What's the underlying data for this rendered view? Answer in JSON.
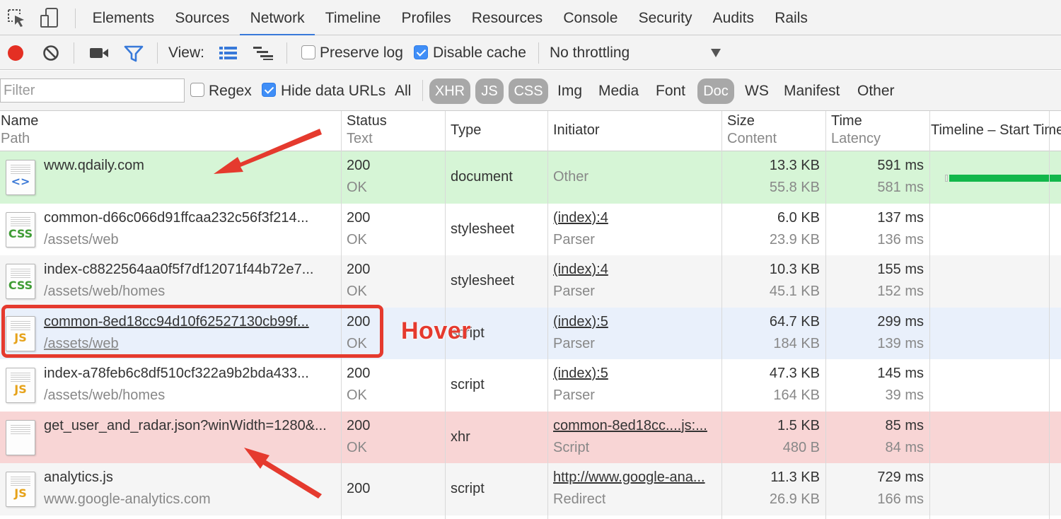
{
  "tabbar": {
    "tabs": [
      "Elements",
      "Sources",
      "Network",
      "Timeline",
      "Profiles",
      "Resources",
      "Console",
      "Security",
      "Audits",
      "Rails"
    ],
    "active": "Network",
    "icons": [
      "inspect-element-icon",
      "device-mode-icon"
    ]
  },
  "toolbar": {
    "view_label": "View:",
    "preserve_log_label": "Preserve log",
    "preserve_log_checked": false,
    "disable_cache_label": "Disable cache",
    "disable_cache_checked": true,
    "throttling_value": "No throttling",
    "icons": [
      "record-icon",
      "clear-icon",
      "capture-screenshots-icon",
      "filter-icon",
      "large-rows-icon",
      "overview-icon",
      "dropdown-arrow-icon"
    ],
    "record_color": "#e42f23",
    "filter_color": "#3879d9"
  },
  "filterbar": {
    "filter_placeholder": "Filter",
    "regex_label": "Regex",
    "regex_checked": false,
    "hide_data_urls_label": "Hide data URLs",
    "hide_data_urls_checked": true,
    "types": [
      {
        "label": "All",
        "selected": false
      },
      {
        "label": "XHR",
        "selected": true
      },
      {
        "label": "JS",
        "selected": true
      },
      {
        "label": "CSS",
        "selected": true
      },
      {
        "label": "Img",
        "selected": false
      },
      {
        "label": "Media",
        "selected": false
      },
      {
        "label": "Font",
        "selected": false
      },
      {
        "label": "Doc",
        "selected": true
      },
      {
        "label": "WS",
        "selected": false
      },
      {
        "label": "Manifest",
        "selected": false
      },
      {
        "label": "Other",
        "selected": false
      }
    ]
  },
  "table": {
    "headers": {
      "name": "Name",
      "path": "Path",
      "status": "Status",
      "text": "Text",
      "type": "Type",
      "initiator": "Initiator",
      "size": "Size",
      "content": "Content",
      "time": "Time",
      "latency": "Latency",
      "timeline": "Timeline – Start Time"
    },
    "rows": [
      {
        "name": "www.qdaily.com",
        "path": "",
        "icon": "html-file-icon",
        "status": "200",
        "text": "OK",
        "type": "document",
        "initiator": "Other",
        "initiator_detail": "",
        "size": "13.3 KB",
        "content": "55.8 KB",
        "time": "591 ms",
        "latency": "581 ms",
        "bg": "#d6f5d6"
      },
      {
        "name": "common-d66c066d91ffcaa232c56f3f214...",
        "path": "/assets/web",
        "icon": "css-file-icon",
        "status": "200",
        "text": "OK",
        "type": "stylesheet",
        "initiator": "(index):4",
        "initiator_detail": "Parser",
        "size": "6.0 KB",
        "content": "23.9 KB",
        "time": "137 ms",
        "latency": "136 ms",
        "bg": "#ffffff"
      },
      {
        "name": "index-c8822564aa0f5f7df12071f44b72e7...",
        "path": "/assets/web/homes",
        "icon": "css-file-icon",
        "status": "200",
        "text": "OK",
        "type": "stylesheet",
        "initiator": "(index):4",
        "initiator_detail": "Parser",
        "size": "10.3 KB",
        "content": "45.1 KB",
        "time": "155 ms",
        "latency": "152 ms",
        "bg": "#f5f5f5"
      },
      {
        "name": "common-8ed18cc94d10f62527130cb99f...",
        "path": "/assets/web",
        "icon": "js-file-icon",
        "status": "200",
        "text": "OK",
        "type": "script",
        "initiator": "(index):5",
        "initiator_detail": "Parser",
        "size": "64.7 KB",
        "content": "184 KB",
        "time": "299 ms",
        "latency": "139 ms",
        "bg": "#e9f0fb"
      },
      {
        "name": "index-a78feb6c8df510cf322a9b2bda433...",
        "path": "/assets/web/homes",
        "icon": "js-file-icon",
        "status": "200",
        "text": "OK",
        "type": "script",
        "initiator": "(index):5",
        "initiator_detail": "Parser",
        "size": "47.3 KB",
        "content": "164 KB",
        "time": "145 ms",
        "latency": "39 ms",
        "bg": "#ffffff"
      },
      {
        "name": "get_user_and_radar.json?winWidth=1280&...",
        "path": "",
        "icon": "blank-file-icon",
        "status": "200",
        "text": "OK",
        "type": "xhr",
        "initiator": "common-8ed18cc....js:...",
        "initiator_detail": "Script",
        "size": "1.5 KB",
        "content": "480 B",
        "time": "85 ms",
        "latency": "84 ms",
        "bg": "#f8d5d5"
      },
      {
        "name": "analytics.js",
        "path": "www.google-analytics.com",
        "icon": "js-file-icon",
        "status": "200",
        "text": "",
        "type": "script",
        "initiator": "http://www.google-ana...",
        "initiator_detail": "Redirect",
        "size": "11.3 KB",
        "content": "26.9 KB",
        "time": "729 ms",
        "latency": "166 ms",
        "bg": "#f5f5f5"
      }
    ]
  },
  "annotations": {
    "hover_label": "Hover",
    "color": "#e53a2e"
  }
}
